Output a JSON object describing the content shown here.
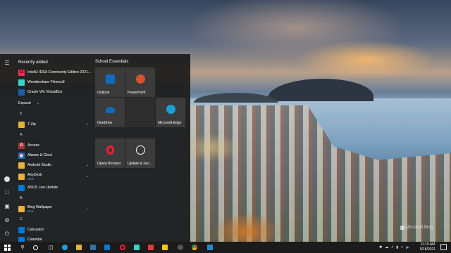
{
  "desktop": {
    "watermark": "Microsoft Bing"
  },
  "start_menu": {
    "recently_added_title": "Recently added",
    "recent": [
      {
        "label": "IntelliJ IDEA Community Edition 2021...",
        "icon": "intellij-icon",
        "color": "#fe2857"
      },
      {
        "label": "Wondershare Filmora9",
        "icon": "filmora-icon",
        "color": "#3ad5c8"
      },
      {
        "label": "Oracle VM VirtualBox",
        "icon": "virtualbox-icon",
        "color": "#1d5ea8"
      }
    ],
    "expand_label": "Expand",
    "letters": {
      "hash": "#",
      "a": "A",
      "b": "B",
      "c": "C"
    },
    "apps": [
      {
        "label": "7-Zip",
        "icon": "folder-icon",
        "sub": ""
      },
      {
        "label": "Access",
        "icon": "access-icon",
        "sub": "",
        "color": "#a4373a"
      },
      {
        "label": "Alarms & Clock",
        "icon": "alarm-icon",
        "sub": "",
        "color": "#0078d4"
      },
      {
        "label": "Android Studio",
        "icon": "folder-icon",
        "sub": ""
      },
      {
        "label": "AnyDesk",
        "icon": "folder-icon",
        "sub": "New"
      },
      {
        "label": "ASUS Live Update",
        "icon": "asus-icon",
        "sub": "",
        "color": "#0078d4"
      },
      {
        "label": "Bing Wallpaper",
        "icon": "folder-icon",
        "sub": "New"
      },
      {
        "label": "Calculator",
        "icon": "calculator-icon",
        "sub": "",
        "color": "#0078d4"
      },
      {
        "label": "Calendar",
        "icon": "calendar-icon",
        "sub": "",
        "color": "#0078d4"
      }
    ],
    "tiles_title": "School Essentials",
    "tiles": [
      {
        "label": "Outlook",
        "icon": "outlook-icon",
        "color": "#0f6cbd"
      },
      {
        "label": "PowerPoint",
        "icon": "powerpoint-icon",
        "color": "#d35230"
      },
      {
        "label": "OneDrive",
        "icon": "onedrive-icon",
        "color": "#0f6cbd"
      },
      {
        "label": "",
        "icon": "",
        "color": ""
      },
      {
        "label": "Microsoft Edge",
        "icon": "edge-icon",
        "color": "#1ba0d8"
      },
      {
        "label": "Opera Browser",
        "icon": "opera-icon",
        "color": "#ff1b2d"
      },
      {
        "label": "Update & Sec...",
        "icon": "update-icon",
        "color": "#ffffff"
      }
    ]
  },
  "taskbar": {
    "time": "11:19 AM",
    "date": "5/18/2021",
    "pinned": [
      "search-icon",
      "cortana-icon",
      "task-view-icon",
      "edge-icon",
      "file-explorer-icon",
      "store-icon",
      "mail-icon",
      "opera-icon",
      "filmora-icon",
      "media-icon",
      "chrome-icon",
      "vscode-icon"
    ]
  }
}
